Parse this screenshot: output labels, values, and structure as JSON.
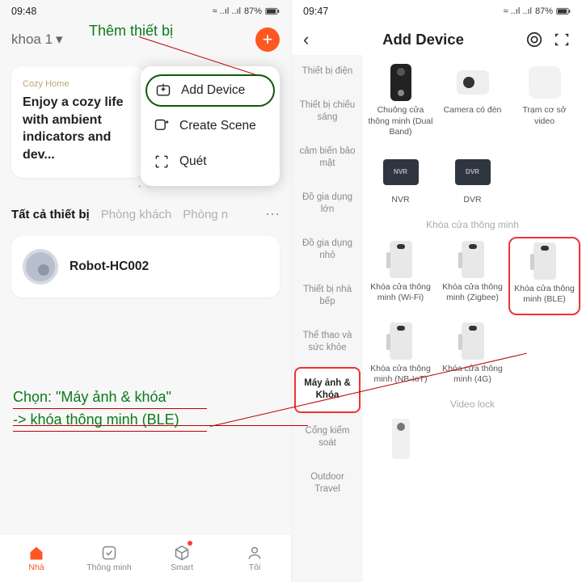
{
  "annotations": {
    "add_device": "Thêm thiết bị",
    "choose_line1": "Chọn: \"Máy ảnh & khóa\"",
    "choose_line2": "-> khóa thông minh (BLE)"
  },
  "left": {
    "status": {
      "time": "09:48",
      "battery": "87%",
      "signal": "≈ ..ıl ..ıl"
    },
    "home_name": "khoa 1",
    "popup": {
      "add": "Add Device",
      "scene": "Create Scene",
      "scan": "Quét"
    },
    "banner": {
      "tag": "Cozy Home",
      "title": "Enjoy a cozy life with ambient indicators and dev..."
    },
    "tabs": {
      "all": "Tất cả thiết bị",
      "room1": "Phòng khách",
      "room2": "Phòng n"
    },
    "device": {
      "name": "Robot-HC002"
    },
    "nav": {
      "home": "Nhà",
      "smart_home": "Thông minh",
      "smart": "Smart",
      "me": "Tôi"
    }
  },
  "right": {
    "status": {
      "time": "09:47",
      "battery": "87%",
      "signal": "≈ ..ıl ..ıl"
    },
    "title": "Add Device",
    "side": {
      "c1": "Thiết bị điện",
      "c2": "Thiết bị chiếu sáng",
      "c3": "cảm biến bảo mật",
      "c4": "Đồ gia dụng lớn",
      "c5": "Đồ gia dụng nhỏ",
      "c6": "Thiết bị nhà bếp",
      "c7": "Thể thao và sức khỏe",
      "c8": "Máy ảnh & Khóa",
      "c9": "Cổng kiểm soát",
      "c10": "Outdoor Travel"
    },
    "section_lock": "Khóa cửa thông minh",
    "section_videolock": "Video lock",
    "items": {
      "doorbell": "Chuông cửa thông minh (Dual Band)",
      "camera": "Camera có đèn",
      "base": "Trạm cơ sở video",
      "nvr": "NVR",
      "dvr": "DVR",
      "nvr_label": "NVR",
      "dvr_label": "DVR",
      "lock_wifi": "Khóa cửa thông minh (Wi-Fi)",
      "lock_zigbee": "Khóa cửa thông minh (Zigbee)",
      "lock_ble": "Khóa cửa thông minh (BLE)",
      "lock_nbiot": "Khóa cửa thông minh (NB-IoT)",
      "lock_4g": "Khóa cửa thông minh (4G)"
    }
  }
}
